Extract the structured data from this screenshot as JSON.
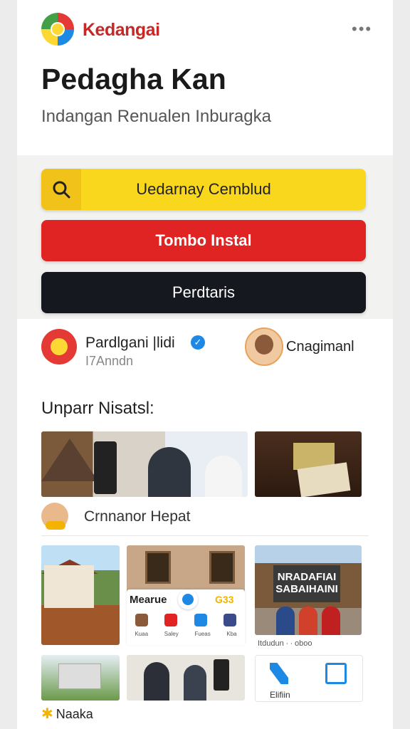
{
  "header": {
    "brand": "Kedangai",
    "more_label": "•••",
    "title": "Pedagha Kan",
    "subtitle": "Indangan Renualen Inburagka"
  },
  "actions": {
    "search_label": "Uedarnay Cemblud",
    "install_label": "Tombo Instal",
    "dark_label": "Perdtaris"
  },
  "profiles": {
    "primary": {
      "name": "Pardlgani |lidi",
      "handle": "I7Anndn"
    },
    "secondary": {
      "name": "Cnagimanl"
    }
  },
  "feed": {
    "section_title": "Unparr Nisatsl:",
    "caption": "Crnnanor Hepat",
    "overlay": {
      "title": "Mearue",
      "tag": "G33",
      "labels": [
        "Kuaa",
        "Saley",
        "Fueas",
        "Kba"
      ]
    },
    "sign_text": "NRADAFIAI SABAIHAINI",
    "photo_caption": "Itdudun ∙ ∙ oboo",
    "card_label": "Elifiin",
    "footer": "Naaka"
  },
  "colors": {
    "brand_red": "#c62828",
    "search_yellow": "#f9d71c",
    "install_red": "#e02424",
    "dark": "#15181e",
    "verified_blue": "#1e88e5"
  },
  "icons": [
    "logo-icon",
    "more-icon",
    "search-icon",
    "verified-icon",
    "star-icon"
  ]
}
